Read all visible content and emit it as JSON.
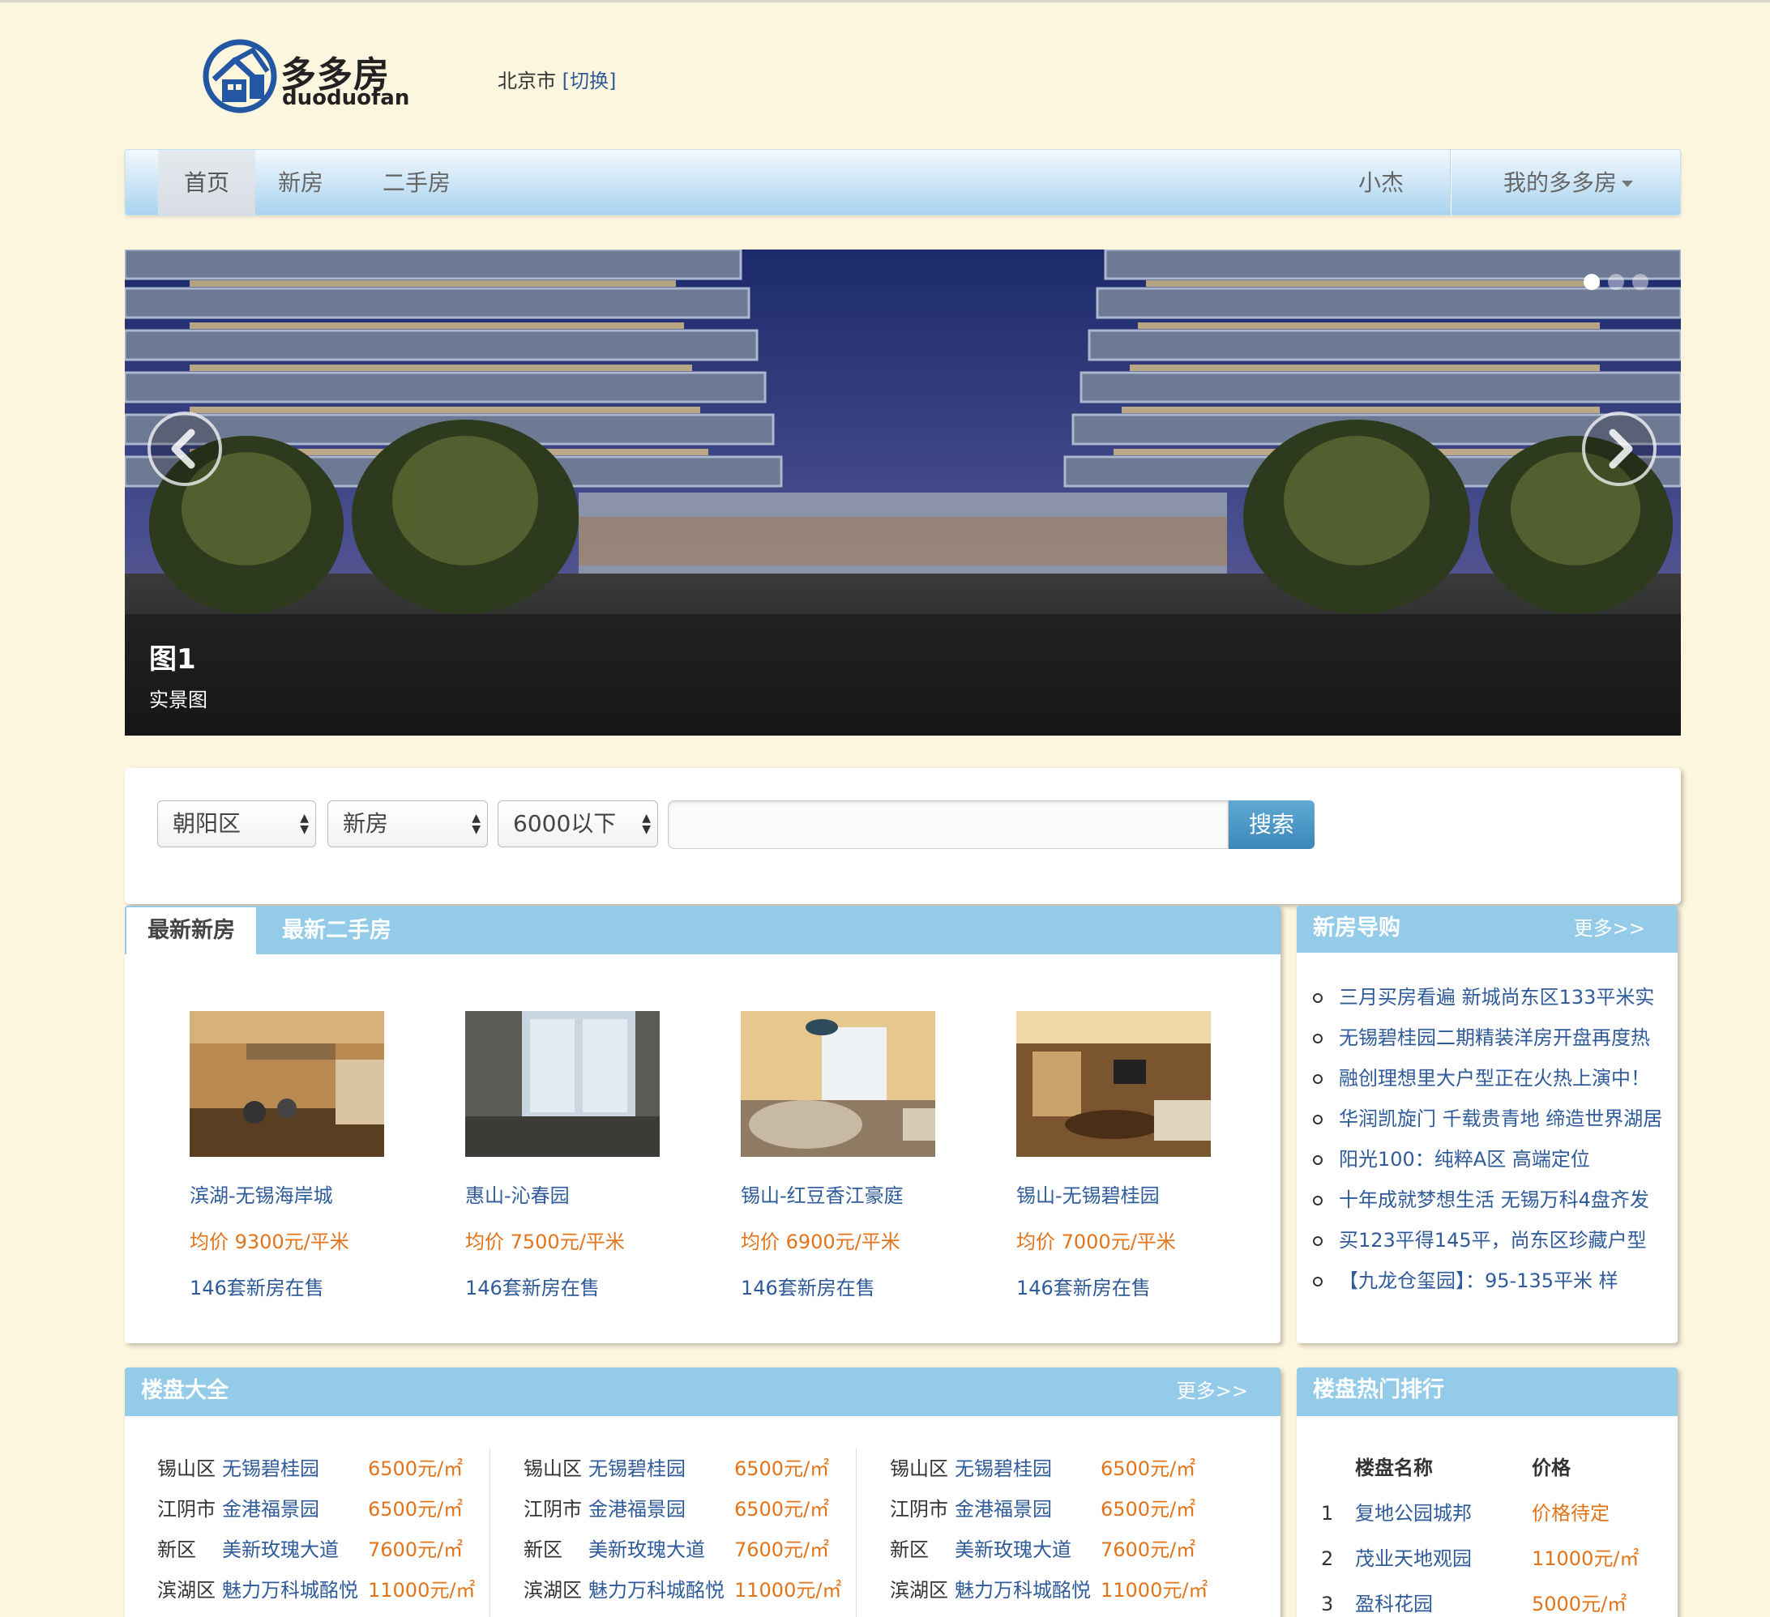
{
  "brand": {
    "name_cn": "多多房",
    "name_en": "duoduofan"
  },
  "location": {
    "city": "北京市",
    "switch_label": "[切换]"
  },
  "nav": {
    "items": [
      "首页",
      "新房",
      "二手房"
    ],
    "user": "小杰",
    "account_menu": "我的多多房"
  },
  "carousel": {
    "title": "图1",
    "subtitle": "实景图",
    "slide_count": 3,
    "active_slide": 1
  },
  "search": {
    "district": "朝阳区",
    "type": "新房",
    "price": "6000以下",
    "query": "",
    "button": "搜索"
  },
  "listings": {
    "tabs": [
      "最新新房",
      "最新二手房"
    ],
    "cards": [
      {
        "name": "滨湖-无锡海岸城",
        "price": "均价 9300元/平米",
        "count": "146套新房在售"
      },
      {
        "name": "惠山-沁春园",
        "price": "均价 7500元/平米",
        "count": "146套新房在售"
      },
      {
        "name": "锡山-红豆香江豪庭",
        "price": "均价 6900元/平米",
        "count": "146套新房在售"
      },
      {
        "name": "锡山-无锡碧桂园",
        "price": "均价 7000元/平米",
        "count": "146套新房在售"
      }
    ]
  },
  "guide": {
    "title": "新房导购",
    "more": "更多>>",
    "items": [
      "三月买房看遍 新城尚东区133平米实",
      "无锡碧桂园二期精装洋房开盘再度热",
      "融创理想里大户型正在火热上演中！",
      "华润凯旋门 千载贵青地 缔造世界湖居",
      "阳光100：纯粹A区 高端定位",
      "十年成就梦想生活 无锡万科4盘齐发",
      "买123平得145平，尚东区珍藏户型",
      "【九龙仓玺园】：95-135平米 样"
    ]
  },
  "estates": {
    "title": "楼盘大全",
    "more": "更多>>",
    "rows": [
      {
        "district": "锡山区",
        "name": "无锡碧桂园",
        "price": "6500元/㎡"
      },
      {
        "district": "江阴市",
        "name": "金港福景园",
        "price": "6500元/㎡"
      },
      {
        "district": "新区",
        "name": "美新玫瑰大道",
        "price": "7600元/㎡"
      },
      {
        "district": "滨湖区",
        "name": "魅力万科城酩悦",
        "price": "11000元/㎡"
      }
    ]
  },
  "ranking": {
    "title": "楼盘热门排行",
    "col_name": "楼盘名称",
    "col_price": "价格",
    "rows": [
      {
        "no": "1",
        "name": "复地公园城邦",
        "price": "价格待定"
      },
      {
        "no": "2",
        "name": "茂业天地观园",
        "price": "11000元/㎡"
      },
      {
        "no": "3",
        "name": "盈科花园",
        "price": "5000元/㎡"
      }
    ]
  }
}
